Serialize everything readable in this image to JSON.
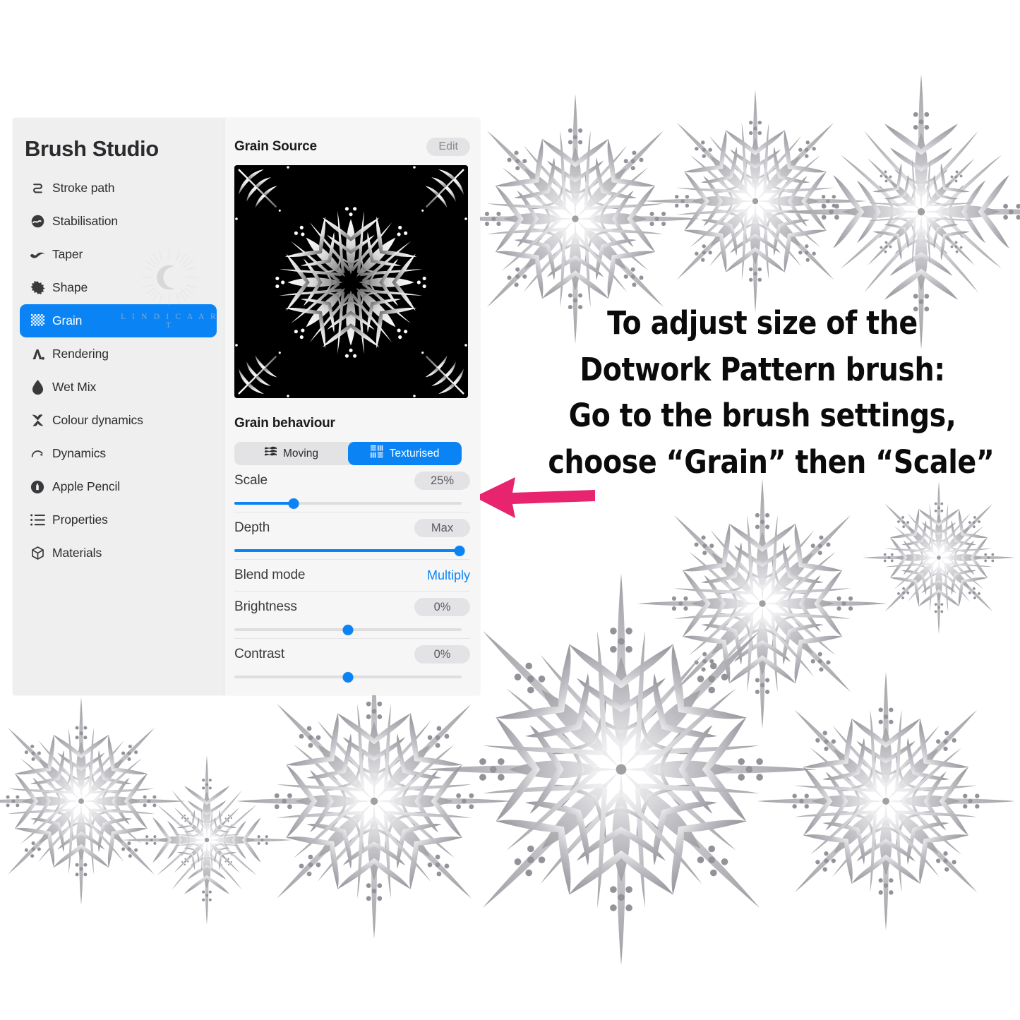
{
  "panel": {
    "title": "Brush Studio",
    "nav": [
      {
        "label": "Stroke path",
        "icon": "stroke-path-icon",
        "active": false
      },
      {
        "label": "Stabilisation",
        "icon": "stabilisation-icon",
        "active": false
      },
      {
        "label": "Taper",
        "icon": "taper-icon",
        "active": false
      },
      {
        "label": "Shape",
        "icon": "shape-icon",
        "active": false
      },
      {
        "label": "Grain",
        "icon": "grain-icon",
        "active": true
      },
      {
        "label": "Rendering",
        "icon": "rendering-icon",
        "active": false
      },
      {
        "label": "Wet Mix",
        "icon": "wet-mix-icon",
        "active": false
      },
      {
        "label": "Colour dynamics",
        "icon": "colour-dynamics-icon",
        "active": false
      },
      {
        "label": "Dynamics",
        "icon": "dynamics-icon",
        "active": false
      },
      {
        "label": "Apple Pencil",
        "icon": "apple-pencil-icon",
        "active": false
      },
      {
        "label": "Properties",
        "icon": "properties-icon",
        "active": false
      },
      {
        "label": "Materials",
        "icon": "materials-icon",
        "active": false
      }
    ],
    "watermark": {
      "text": "L I N D I C A   A R T",
      "icon": "crescent-moon-burst-icon"
    }
  },
  "grain_source": {
    "title": "Grain Source",
    "edit_label": "Edit",
    "preview_alt": "snowflake-grain-texture"
  },
  "grain_behaviour": {
    "title": "Grain behaviour",
    "mode_options": [
      {
        "label": "Moving",
        "icon": "moving-icon",
        "selected": false
      },
      {
        "label": "Texturised",
        "icon": "texturised-icon",
        "selected": true
      }
    ],
    "scale": {
      "label": "Scale",
      "value": "25%",
      "percent": 26
    },
    "depth": {
      "label": "Depth",
      "value": "Max",
      "percent": 100
    },
    "blend_mode": {
      "label": "Blend mode",
      "value": "Multiply"
    },
    "brightness": {
      "label": "Brightness",
      "value": "0%",
      "percent": 50
    },
    "contrast": {
      "label": "Contrast",
      "value": "0%",
      "percent": 50
    }
  },
  "instructions": {
    "line1": "To adjust size of the",
    "line2": "Dotwork Pattern brush:",
    "line3": "Go to the brush settings,",
    "line4": "choose “Grain” then “Scale”"
  },
  "colors": {
    "accent_blue": "#0a84f5",
    "arrow_pink": "#e8246e",
    "sidebar_bg": "#efeff0",
    "detail_bg": "#f6f6f7",
    "pill_bg": "#e3e3e5"
  }
}
